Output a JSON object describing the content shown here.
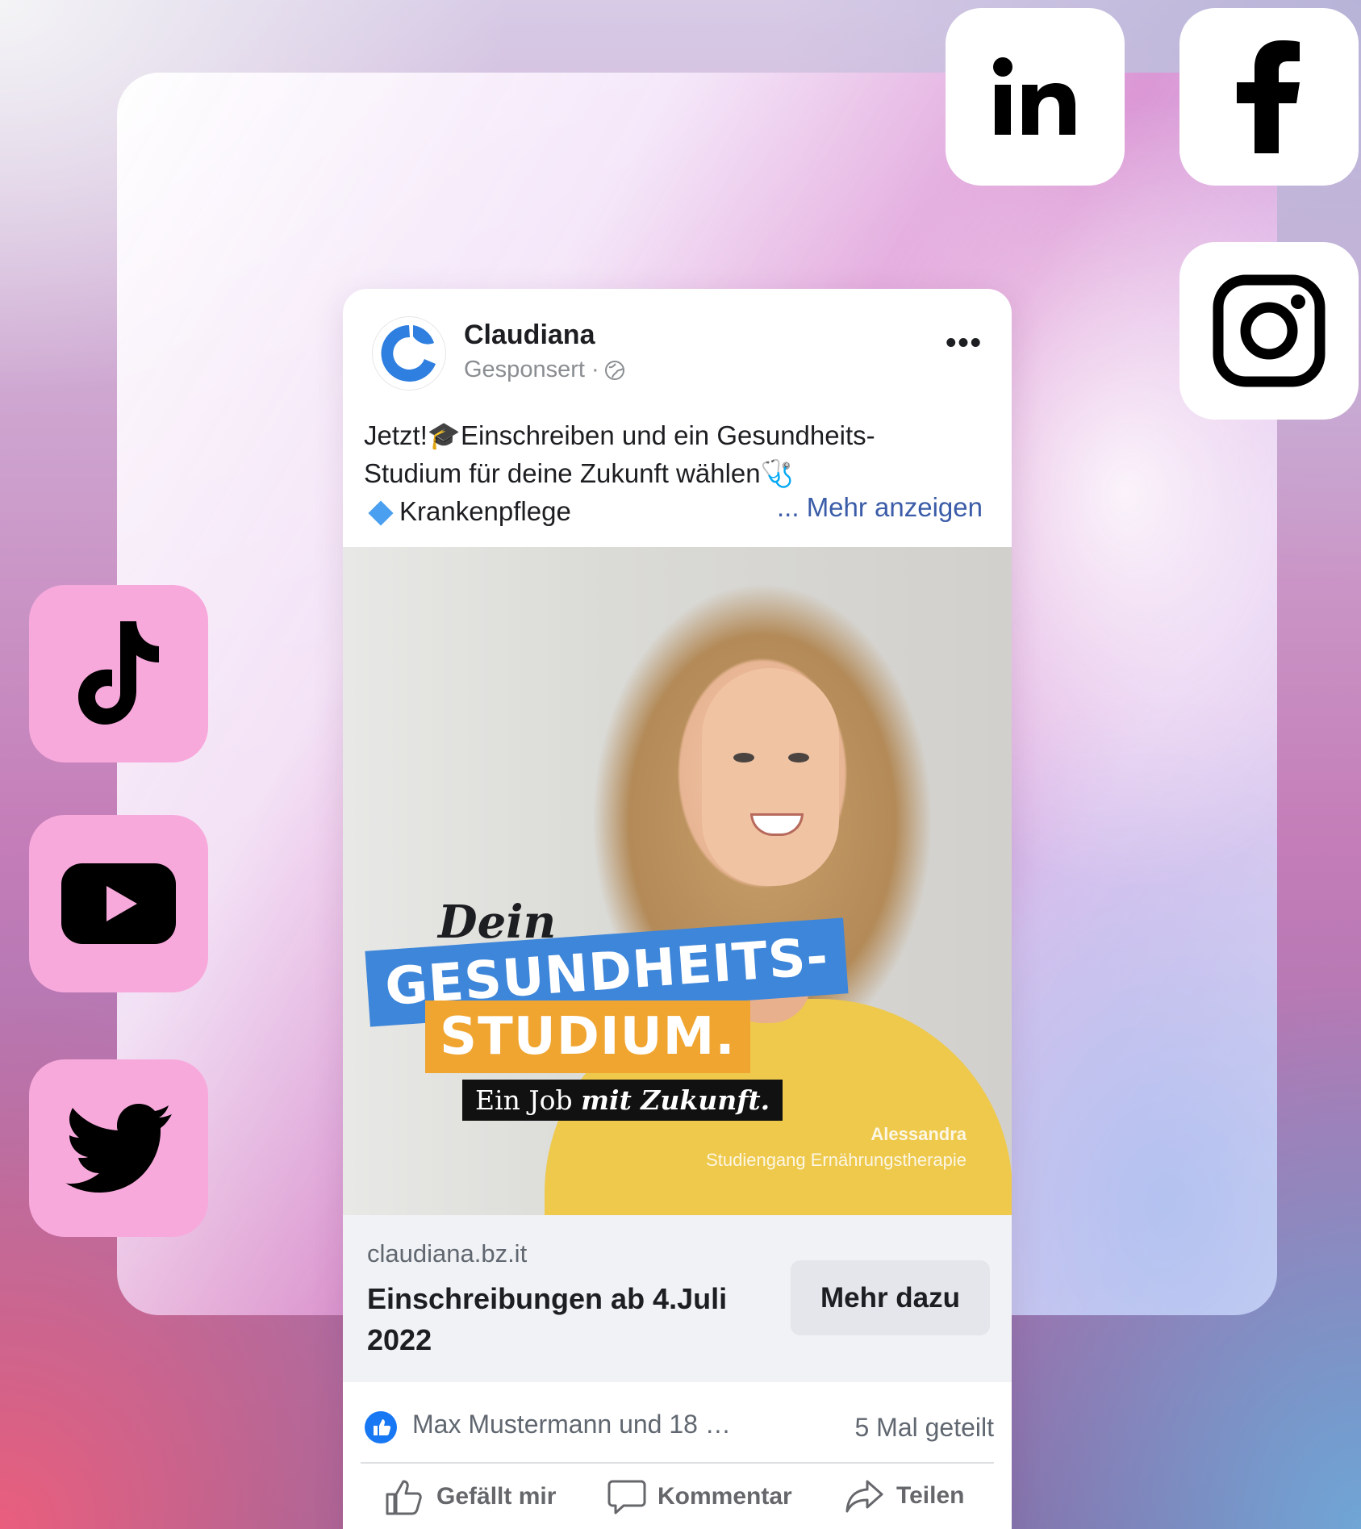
{
  "social_icons": [
    {
      "name": "linkedin-icon",
      "label": "in"
    },
    {
      "name": "facebook-icon",
      "label": "f"
    },
    {
      "name": "instagram-icon"
    },
    {
      "name": "tiktok-icon"
    },
    {
      "name": "youtube-icon"
    },
    {
      "name": "twitter-icon"
    }
  ],
  "post": {
    "page_name": "Claudiana",
    "sponsored_label": "Gesponsert ·",
    "text_line1": "Jetzt!🎓Einschreiben und ein Gesundheits-",
    "text_line2": "Studium für deine Zukunft wählen🩺",
    "text_line3": "Krankenpflege",
    "see_more": "... Mehr anzeigen"
  },
  "ad_image": {
    "headline_small": "Dein",
    "headline_band1": "GESUNDHEITS-",
    "headline_band2": "STUDIUM.",
    "tagline_regular": "Ein Job ",
    "tagline_emphasis": "mit Zukunft.",
    "credit_name": "Alessandra",
    "credit_role": "Studiengang Ernährungstherapie"
  },
  "cta": {
    "domain": "claudiana.bz.it",
    "headline": "Einschreibungen ab 4.Juli 2022",
    "button_label": "Mehr dazu"
  },
  "engagement": {
    "likes_text": "Max Mustermann und 18 …",
    "shares_text": "5 Mal geteilt",
    "like_action": "Gefällt mir",
    "comment_action": "Kommentar",
    "share_action": "Teilen"
  },
  "colors": {
    "facebook_blue": "#1877f2",
    "brand_blue": "#3e86d9",
    "brand_orange": "#f0a531",
    "shirt_yellow": "#eec94c"
  }
}
